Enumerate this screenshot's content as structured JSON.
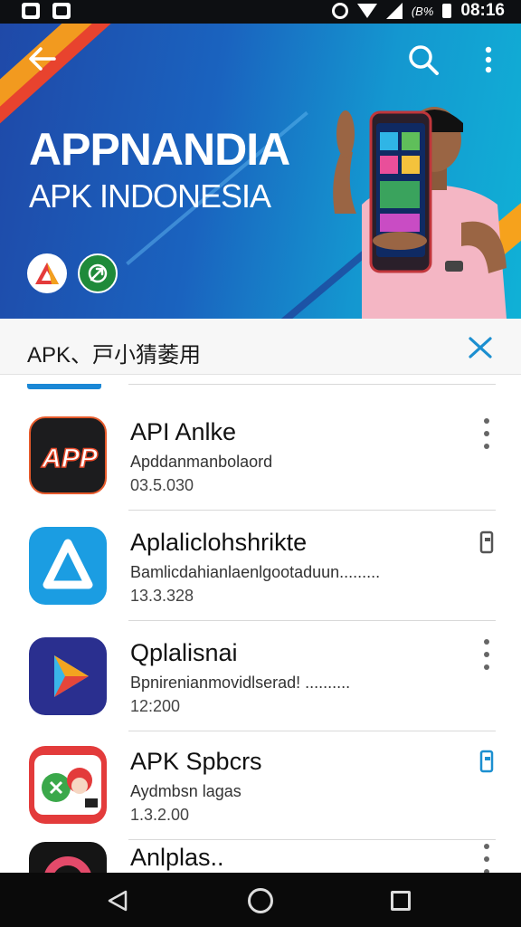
{
  "status_bar": {
    "time": "08:16",
    "battery_text": "(B%"
  },
  "banner": {
    "title": "APPNANDIA",
    "subtitle": "APK INDONESIA"
  },
  "search": {
    "query": "APK、戸小猜萎用"
  },
  "apps": [
    {
      "name": "API Anlke",
      "desc": "Apddanmanbolaord",
      "size": "03.5.030",
      "icon": "app-logo-icon",
      "menu": "more-vert-icon"
    },
    {
      "name": "Aplaliclohshrikte",
      "desc": "Bamlicdahianlaenlgootaduun.........",
      "size": "13.3.328",
      "icon": "triangle-a-icon",
      "menu": "bookmark-icon"
    },
    {
      "name": "Qplalisnai",
      "desc": "Bpnirenianmovidlserad!          ..........",
      "size": "12:200",
      "icon": "play-triangle-icon",
      "menu": "more-vert-icon"
    },
    {
      "name": "APK Spbcrs",
      "desc": "Aydmbsn lagas",
      "size": "1.3.2.00",
      "icon": "cartoon-chat-icon",
      "menu": "bookmark-icon"
    },
    {
      "name": "Anlplas..",
      "desc": "",
      "size": "",
      "icon": "ring-icon",
      "menu": "more-vert-icon"
    }
  ],
  "colors": {
    "banner_blue": "#1a63bf",
    "accent_orange": "#f29a1f",
    "accent_red": "#e8432e",
    "link_blue": "#1b88d6"
  }
}
